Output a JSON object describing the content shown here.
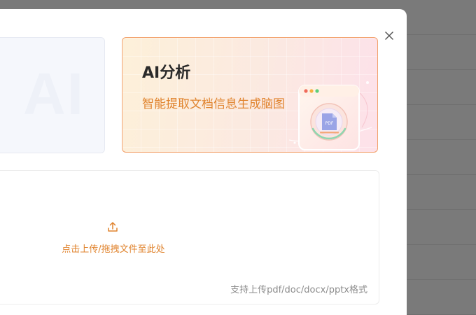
{
  "modal": {
    "close_icon": "close-icon"
  },
  "left_card": {
    "watermark": "AI"
  },
  "ai_card": {
    "title": "AI分析",
    "subtitle": "智能提取文档信息生成脑图",
    "illustration_label": "PDF",
    "border_color": "#f2a06a",
    "accent_color": "#e0832d"
  },
  "upload": {
    "icon": "upload-icon",
    "action_text": "点击上传/拖拽文件至此处",
    "hint_text": "支持上传pdf/doc/docx/pptx格式"
  }
}
